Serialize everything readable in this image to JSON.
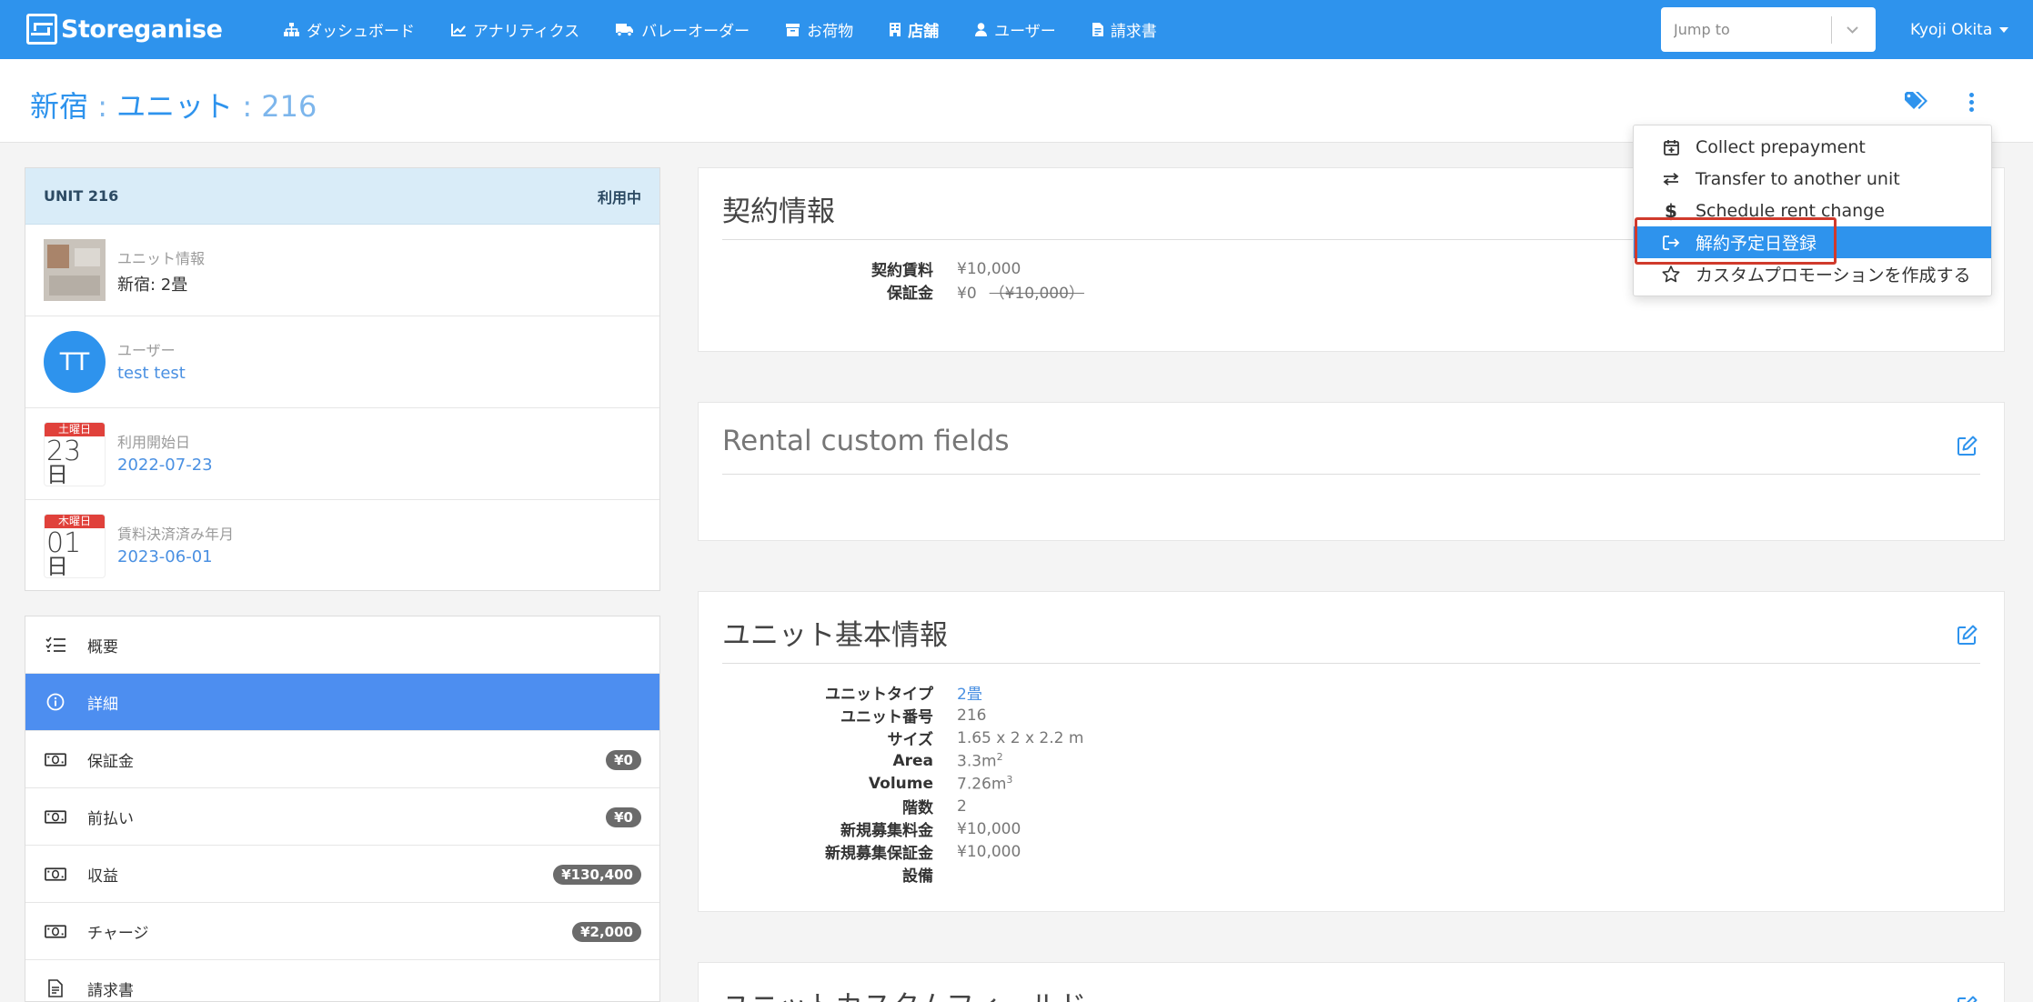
{
  "app": {
    "brand": "Storeganise",
    "nav": [
      {
        "label": "ダッシュボード",
        "icon": "sitemap-icon"
      },
      {
        "label": "アナリティクス",
        "icon": "chart-line-icon"
      },
      {
        "label": "バレーオーダー",
        "icon": "truck-icon"
      },
      {
        "label": "お荷物",
        "icon": "archive-icon"
      },
      {
        "label": "店舗",
        "icon": "building-icon"
      },
      {
        "label": "ユーザー",
        "icon": "user-icon"
      },
      {
        "label": "請求書",
        "icon": "invoice-icon"
      }
    ],
    "jump_placeholder": "Jump to",
    "user_name": "Kyoji Okita"
  },
  "header": {
    "store": "新宿",
    "sep1": " : ",
    "section": "ユニット",
    "sep2": " : ",
    "unit_no": "216"
  },
  "dropdown": {
    "items": [
      {
        "label": "Collect prepayment",
        "icon": "calendar-plus-icon"
      },
      {
        "label": "Transfer to another unit",
        "icon": "exchange-icon"
      },
      {
        "label": "Schedule rent change",
        "icon": "dollar-icon"
      },
      {
        "label": "解約予定日登録",
        "icon": "sign-out-icon"
      },
      {
        "label": "カスタムプロモーションを作成する",
        "icon": "star-icon"
      }
    ],
    "active_index": 3
  },
  "unit_card": {
    "title": "UNIT 216",
    "status": "利用中",
    "rows": [
      {
        "label": "ユニット情報",
        "value": "新宿: 2畳"
      },
      {
        "label": "ユーザー",
        "value": "test test",
        "avatar": "TT"
      },
      {
        "label": "利用開始日",
        "value": "2022-07-23",
        "cal_dow": "土曜日",
        "cal_day": "23",
        "cal_suffix": "日"
      },
      {
        "label": "賃料決済済み年月",
        "value": "2023-06-01",
        "cal_dow": "木曜日",
        "cal_day": "01",
        "cal_suffix": "日"
      }
    ]
  },
  "side_menu": [
    {
      "label": "概要",
      "icon": "checklist-icon",
      "badge": ""
    },
    {
      "label": "詳細",
      "icon": "info-circle-icon",
      "badge": ""
    },
    {
      "label": "保証金",
      "icon": "money-bill-icon",
      "badge": "¥0"
    },
    {
      "label": "前払い",
      "icon": "money-bill-icon",
      "badge": "¥0"
    },
    {
      "label": "収益",
      "icon": "money-bill-icon",
      "badge": "¥130,400"
    },
    {
      "label": "チャージ",
      "icon": "money-bill-icon",
      "badge": "¥2,000"
    },
    {
      "label": "請求書",
      "icon": "invoice-icon",
      "badge": ""
    }
  ],
  "contract": {
    "title": "契約情報",
    "rows": [
      {
        "key": "契約賃料",
        "value": "¥10,000"
      },
      {
        "key": "保証金",
        "value": "¥0",
        "struck": "（¥10,000）"
      }
    ]
  },
  "rental_custom": {
    "title": "Rental custom fields"
  },
  "unit_basic": {
    "title": "ユニット基本情報",
    "rows": [
      {
        "key": "ユニットタイプ",
        "value": "2畳"
      },
      {
        "key": "ユニット番号",
        "value": "216"
      },
      {
        "key": "サイズ",
        "value": "1.65 x 2 x 2.2 m"
      },
      {
        "key": "Area",
        "value": "3.3m",
        "sup": "2"
      },
      {
        "key": "Volume",
        "value": "7.26m",
        "sup": "3"
      },
      {
        "key": "階数",
        "value": "2"
      },
      {
        "key": "新規募集料金",
        "value": "¥10,000"
      },
      {
        "key": "新規募集保証金",
        "value": "¥10,000"
      },
      {
        "key": "設備",
        "value": ""
      }
    ]
  },
  "unit_custom": {
    "title": "ユニットカスタムフィールド"
  },
  "colors": {
    "primary": "#2e93ed",
    "active_menu": "#4d8ef0",
    "highlight": "#d03a2c",
    "calendar_red": "#e0413b"
  }
}
